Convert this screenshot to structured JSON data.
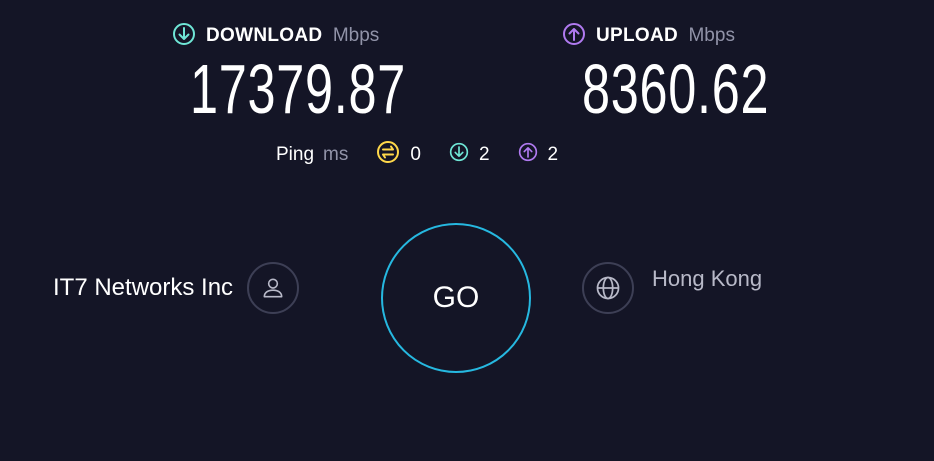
{
  "download": {
    "label": "DOWNLOAD",
    "unit": "Mbps",
    "value": "17379.87",
    "icon": "download-arrow-icon",
    "color": "#6fe6d6"
  },
  "upload": {
    "label": "UPLOAD",
    "unit": "Mbps",
    "value": "8360.62",
    "icon": "upload-arrow-icon",
    "color": "#b07af0"
  },
  "ping": {
    "label": "Ping",
    "unit": "ms",
    "idle": "0",
    "download": "2",
    "upload": "2",
    "idle_color": "#ffd84a"
  },
  "isp": {
    "name": "IT7 Networks Inc",
    "icon": "user-icon"
  },
  "go_button": {
    "label": "GO",
    "ring_color": "#26b8e0"
  },
  "server": {
    "location": "Hong Kong",
    "icon": "globe-icon"
  }
}
